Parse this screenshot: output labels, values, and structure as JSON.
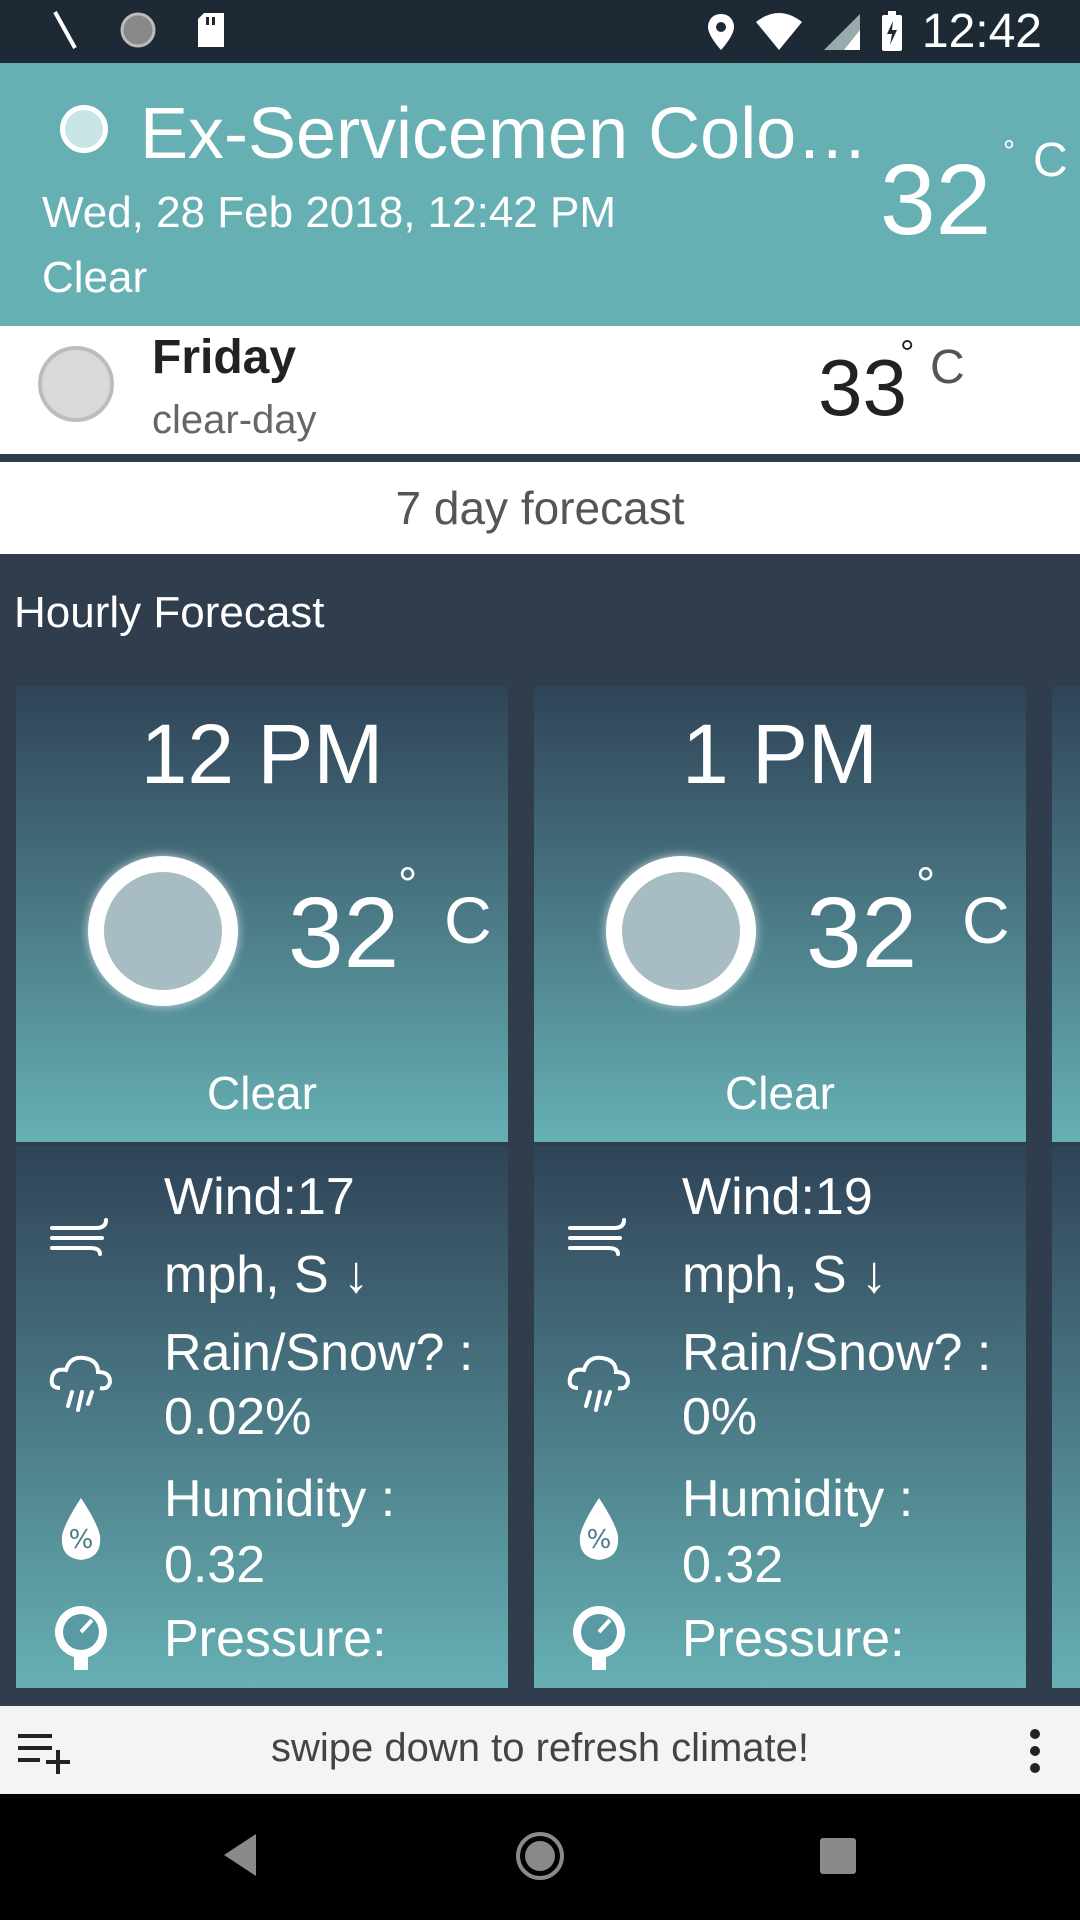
{
  "status_bar": {
    "time": "12:42"
  },
  "current": {
    "location": "Ex-Servicemen Colo…",
    "datetime": "Wed, 28 Feb 2018, 12:42 PM",
    "condition": "Clear",
    "temperature": "32",
    "degree_symbol": "°",
    "unit": "C"
  },
  "tomorrow": {
    "day": "Friday",
    "summary": "clear-day",
    "temperature": "33",
    "degree_symbol": "°",
    "unit": "C"
  },
  "seven_day_label": "7 day forecast",
  "hourly": {
    "title": "Hourly Forecast",
    "cards": [
      {
        "time": "12 PM",
        "temperature": "32",
        "degree_symbol": "°",
        "unit": "C",
        "condition": "Clear",
        "wind_line1": "Wind:17",
        "wind_line2": "mph, S ↓",
        "rain_line1": "Rain/Snow? :",
        "rain_line2": "0.02%",
        "humidity_line1": "Humidity :",
        "humidity_line2": "0.32",
        "pressure_line1": "Pressure:"
      },
      {
        "time": "1 PM",
        "temperature": "32",
        "degree_symbol": "°",
        "unit": "C",
        "condition": "Clear",
        "wind_line1": "Wind:19",
        "wind_line2": "mph, S ↓",
        "rain_line1": "Rain/Snow? :",
        "rain_line2": "0%",
        "humidity_line1": "Humidity :",
        "humidity_line2": "0.32",
        "pressure_line1": "Pressure:"
      }
    ]
  },
  "bottom_bar": {
    "hint": "swipe down to refresh climate!"
  },
  "icons": {
    "wind": "wind-icon",
    "rain": "rain-cloud-icon",
    "humidity": "humidity-drop-icon",
    "pressure": "pressure-gauge-icon"
  },
  "colors": {
    "header": "#66b0b4",
    "card_top": "#2f4357",
    "card_bottom": "#66b0b4",
    "background": "#2f3d4d"
  }
}
